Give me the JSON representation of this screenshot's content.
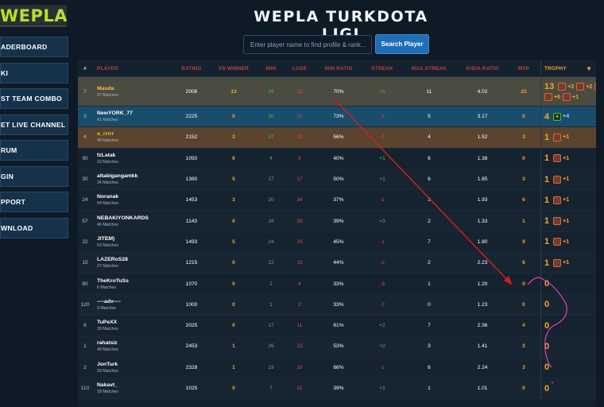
{
  "logo": "WEPLA",
  "sidebar": {
    "items": [
      {
        "label": "ADERBOARD"
      },
      {
        "label": "KI"
      },
      {
        "label": "ST TEAM COMBO"
      },
      {
        "label": "ET LIVE CHANNEL"
      },
      {
        "label": "RUM"
      },
      {
        "label": "GIN"
      },
      {
        "label": "PPORT"
      },
      {
        "label": "WNLOAD"
      }
    ]
  },
  "header": {
    "title": "WEPLA TURKDOTA LIGI",
    "search_placeholder": "Enter player name to find profile & rank...",
    "search_button": "Search Player"
  },
  "table": {
    "columns": [
      "#",
      "PLAYER",
      "RATING",
      "VS WINNER",
      "WIN",
      "LOSE",
      "WIN RATIO",
      "STREAK",
      "MAX.STREAK",
      "K/D/A RATIO",
      "MVP",
      "TROPHY"
    ],
    "rows": [
      {
        "rank": "7",
        "name": "Mauda",
        "matches": "37 Matches",
        "rating": "2008",
        "vsw": "13",
        "win": "26",
        "lose": "11",
        "wr": "70%",
        "streak": "+1",
        "mstreak": "11",
        "kda": "4.02",
        "mvp": "23",
        "trophy_count": "13"
      },
      {
        "rank": "3",
        "name": "NewYORK_77",
        "matches": "41 Matches",
        "rating": "2225",
        "vsw": "0",
        "win": "30",
        "lose": "11",
        "wr": "73%",
        "streak": "-1",
        "mstreak": "5",
        "kda": "3.17",
        "mvp": "5",
        "trophy_count": "4"
      },
      {
        "rank": "4",
        "name": "o_rrrrr",
        "matches": "48 Matches",
        "rating": "2152",
        "vsw": "2",
        "win": "27",
        "lose": "21",
        "wr": "56%",
        "streak": "-7",
        "mstreak": "4",
        "kda": "1.52",
        "mvp": "3",
        "trophy_count": "1"
      },
      {
        "rank": "90",
        "name": "fzLatak",
        "matches": "10 Matches",
        "rating": "1050",
        "vsw": "6",
        "win": "4",
        "lose": "6",
        "wr": "40%",
        "streak": "+1",
        "mstreak": "6",
        "kda": "1.38",
        "mvp": "0",
        "trophy_count": "1"
      },
      {
        "rank": "30",
        "name": "altabigangamkk",
        "matches": "34 Matches",
        "rating": "1380",
        "vsw": "5",
        "win": "17",
        "lose": "17",
        "wr": "50%",
        "streak": "+1",
        "mstreak": "6",
        "kda": "1.85",
        "mvp": "3",
        "trophy_count": "1"
      },
      {
        "rank": "24",
        "name": "Noranak",
        "matches": "54 Matches",
        "rating": "1453",
        "vsw": "3",
        "win": "20",
        "lose": "34",
        "wr": "37%",
        "streak": "-1",
        "mstreak": "3",
        "kda": "1.93",
        "mvp": "6",
        "trophy_count": "1"
      },
      {
        "rank": "57",
        "name": "NEBAKIYONKARDS",
        "matches": "46 Matches",
        "rating": "1143",
        "vsw": "0",
        "win": "18",
        "lose": "28",
        "wr": "39%",
        "streak": "+3",
        "mstreak": "2",
        "kda": "1.33",
        "mvp": "1",
        "trophy_count": "1"
      },
      {
        "rank": "22",
        "name": "JITEM)",
        "matches": "53 Matches",
        "rating": "1493",
        "vsw": "5",
        "win": "24",
        "lose": "29",
        "wr": "45%",
        "streak": "-1",
        "mstreak": "7",
        "kda": "1.80",
        "mvp": "9",
        "trophy_count": "1"
      },
      {
        "rank": "15",
        "name": "LAZERoS28",
        "matches": "27 Matches",
        "rating": "1215",
        "vsw": "0",
        "win": "12",
        "lose": "15",
        "wr": "44%",
        "streak": "-2",
        "mstreak": "2",
        "kda": "2.23",
        "mvp": "6",
        "trophy_count": "1"
      },
      {
        "rank": "80",
        "name": "TheKroTuSs",
        "matches": "6 Matches",
        "rating": "1070",
        "vsw": "0",
        "win": "2",
        "lose": "4",
        "wr": "33%",
        "streak": "-3",
        "mstreak": "1",
        "kda": "1.20",
        "mvp": "0",
        "trophy_count": "0"
      },
      {
        "rank": "120",
        "name": "----adv----",
        "matches": "3 Matches",
        "rating": "1000",
        "vsw": "0",
        "win": "1",
        "lose": "2",
        "wr": "33%",
        "streak": "-2",
        "mstreak": "0",
        "kda": "1.23",
        "mvp": "0",
        "trophy_count": "0"
      },
      {
        "rank": "6",
        "name": "TuPeXX",
        "matches": "28 Matches",
        "rating": "2025",
        "vsw": "0",
        "win": "17",
        "lose": "11",
        "wr": "61%",
        "streak": "+2",
        "mstreak": "7",
        "kda": "2.36",
        "mvp": "4",
        "trophy_count": "0"
      },
      {
        "rank": "1",
        "name": "rahatsiz",
        "matches": "49 Matches",
        "rating": "2453",
        "vsw": "1",
        "win": "26",
        "lose": "23",
        "wr": "53%",
        "streak": "+2",
        "mstreak": "3",
        "kda": "1.41",
        "mvp": "3",
        "trophy_count": "0"
      },
      {
        "rank": "2",
        "name": "JonTurk",
        "matches": "29 Matches",
        "rating": "2328",
        "vsw": "1",
        "win": "19",
        "lose": "10",
        "wr": "66%",
        "streak": "-1",
        "mstreak": "6",
        "kda": "2.24",
        "mvp": "3",
        "trophy_count": "0"
      },
      {
        "rank": "110",
        "name": "Nakavt_",
        "matches": "18 Matches",
        "rating": "1025",
        "vsw": "0",
        "win": "7",
        "lose": "11",
        "wr": "39%",
        "streak": "+1",
        "mstreak": "1",
        "kda": "1.01",
        "mvp": "0",
        "trophy_count": "0"
      }
    ],
    "trophy_badges": {
      "r0": [
        "+2",
        "+2",
        "+2",
        "+6",
        "+1"
      ],
      "r1": [
        "+4"
      ],
      "single": "+1"
    }
  },
  "colors": {
    "accent": "#f5a623",
    "win": "#3bbf4a",
    "lose": "#e04545",
    "button": "#1f6fb6",
    "annotation_arrow": "#cc1f1f",
    "annotation_scribble": "#e040b0"
  }
}
